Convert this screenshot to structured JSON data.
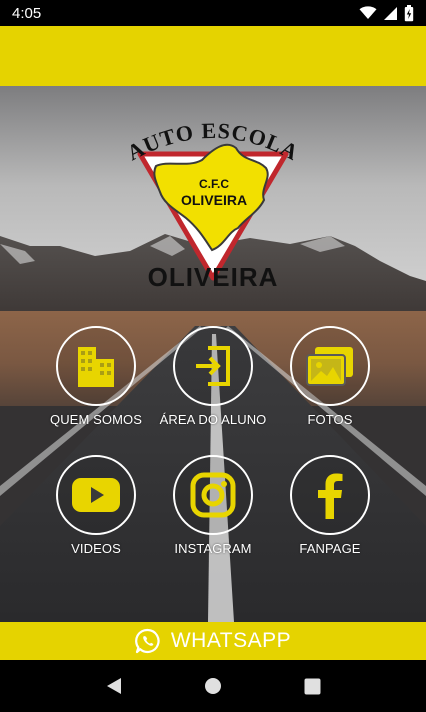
{
  "status_bar": {
    "time": "4:05",
    "icons": [
      "wifi-icon",
      "signal-icon",
      "battery-charging-icon"
    ]
  },
  "logo": {
    "top_text": "AUTO ESCOLA",
    "badge_line1": "C.F.C",
    "badge_line2": "OLIVEIRA",
    "bottom_text": "OLIVEIRA"
  },
  "menu": {
    "items": [
      {
        "label": "QUEM SOMOS",
        "icon": "building-icon"
      },
      {
        "label": "ÁREA DO ALUNO",
        "icon": "login-door-icon"
      },
      {
        "label": "FOTOS",
        "icon": "photos-icon"
      },
      {
        "label": "VIDEOS",
        "icon": "youtube-icon"
      },
      {
        "label": "INSTAGRAM",
        "icon": "instagram-icon"
      },
      {
        "label": "FANPAGE",
        "icon": "facebook-icon"
      }
    ]
  },
  "whatsapp": {
    "label": "WHATSAPP",
    "icon": "whatsapp-icon"
  },
  "nav": {
    "buttons": [
      "back-icon",
      "home-icon",
      "recents-icon"
    ]
  },
  "colors": {
    "accent": "#e5d300",
    "icon_yellow": "#e8d500",
    "logo_red": "#c0272d",
    "logo_yellow": "#f2e000"
  }
}
